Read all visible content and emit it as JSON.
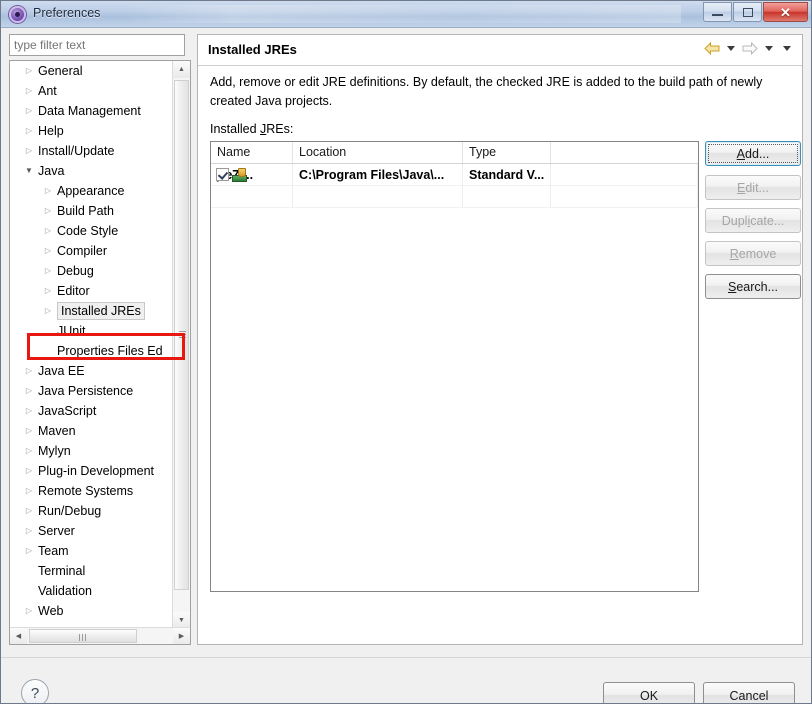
{
  "window": {
    "title": "Preferences",
    "icon": "preferences-icon",
    "controls": {
      "minimize": "minimize-icon",
      "maximize": "maximize-icon",
      "close": "✕"
    }
  },
  "sidebar": {
    "filter": {
      "placeholder": "type filter text",
      "value": ""
    },
    "items": [
      {
        "label": "General",
        "level": 0,
        "arrow": "collapsed",
        "selected": false
      },
      {
        "label": "Ant",
        "level": 0,
        "arrow": "collapsed",
        "selected": false
      },
      {
        "label": "Data Management",
        "level": 0,
        "arrow": "collapsed",
        "selected": false
      },
      {
        "label": "Help",
        "level": 0,
        "arrow": "collapsed",
        "selected": false
      },
      {
        "label": "Install/Update",
        "level": 0,
        "arrow": "collapsed",
        "selected": false
      },
      {
        "label": "Java",
        "level": 0,
        "arrow": "expanded",
        "selected": false
      },
      {
        "label": "Appearance",
        "level": 1,
        "arrow": "collapsed",
        "selected": false
      },
      {
        "label": "Build Path",
        "level": 1,
        "arrow": "collapsed",
        "selected": false
      },
      {
        "label": "Code Style",
        "level": 1,
        "arrow": "collapsed",
        "selected": false
      },
      {
        "label": "Compiler",
        "level": 1,
        "arrow": "collapsed",
        "selected": false
      },
      {
        "label": "Debug",
        "level": 1,
        "arrow": "collapsed",
        "selected": false
      },
      {
        "label": "Editor",
        "level": 1,
        "arrow": "collapsed",
        "selected": false
      },
      {
        "label": "Installed JREs",
        "level": 1,
        "arrow": "collapsed",
        "selected": true
      },
      {
        "label": "JUnit",
        "level": 1,
        "arrow": "none",
        "selected": false
      },
      {
        "label": "Properties Files Ed",
        "level": 1,
        "arrow": "none",
        "selected": false
      },
      {
        "label": "Java EE",
        "level": 0,
        "arrow": "collapsed",
        "selected": false
      },
      {
        "label": "Java Persistence",
        "level": 0,
        "arrow": "collapsed",
        "selected": false
      },
      {
        "label": "JavaScript",
        "level": 0,
        "arrow": "collapsed",
        "selected": false
      },
      {
        "label": "Maven",
        "level": 0,
        "arrow": "collapsed",
        "selected": false
      },
      {
        "label": "Mylyn",
        "level": 0,
        "arrow": "collapsed",
        "selected": false
      },
      {
        "label": "Plug-in Development",
        "level": 0,
        "arrow": "collapsed",
        "selected": false
      },
      {
        "label": "Remote Systems",
        "level": 0,
        "arrow": "collapsed",
        "selected": false
      },
      {
        "label": "Run/Debug",
        "level": 0,
        "arrow": "collapsed",
        "selected": false
      },
      {
        "label": "Server",
        "level": 0,
        "arrow": "collapsed",
        "selected": false
      },
      {
        "label": "Team",
        "level": 0,
        "arrow": "collapsed",
        "selected": false
      },
      {
        "label": "Terminal",
        "level": 0,
        "arrow": "none",
        "selected": false
      },
      {
        "label": "Validation",
        "level": 0,
        "arrow": "none",
        "selected": false
      },
      {
        "label": "Web",
        "level": 0,
        "arrow": "collapsed",
        "selected": false
      }
    ]
  },
  "content": {
    "title": "Installed JREs",
    "description": "Add, remove or edit JRE definitions. By default, the checked JRE is added to the build path of newly created Java projects.",
    "table_label_prefix": "Installed ",
    "table_label_mnemonic": "J",
    "table_label_suffix": "REs:",
    "nav": {
      "back": "back-arrow-icon",
      "forward": "forward-arrow-icon",
      "menu": "view-menu-icon"
    }
  },
  "table": {
    "columns": [
      "Name",
      "Location",
      "Type"
    ],
    "rows": [
      {
        "checked": true,
        "icon": "jre-icon",
        "name": "jre7 ...",
        "location": "C:\\Program Files\\Java\\...",
        "type": "Standard V..."
      }
    ]
  },
  "buttons": {
    "add": {
      "prefix": "",
      "mnemonic": "A",
      "suffix": "dd...",
      "enabled": true,
      "focused": true
    },
    "edit": {
      "prefix": "",
      "mnemonic": "E",
      "suffix": "dit...",
      "enabled": false
    },
    "duplicate": {
      "prefix": "Dupl",
      "mnemonic": "i",
      "suffix": "cate...",
      "enabled": false
    },
    "remove": {
      "prefix": "",
      "mnemonic": "R",
      "suffix": "emove",
      "enabled": false
    },
    "search": {
      "prefix": "",
      "mnemonic": "S",
      "suffix": "earch...",
      "enabled": true
    }
  },
  "footer": {
    "help": "?",
    "ok": "OK",
    "cancel": "Cancel"
  },
  "colors": {
    "annotation": "#e8170f",
    "focus": "#3c8fb5",
    "close_button": "#c9352b"
  }
}
